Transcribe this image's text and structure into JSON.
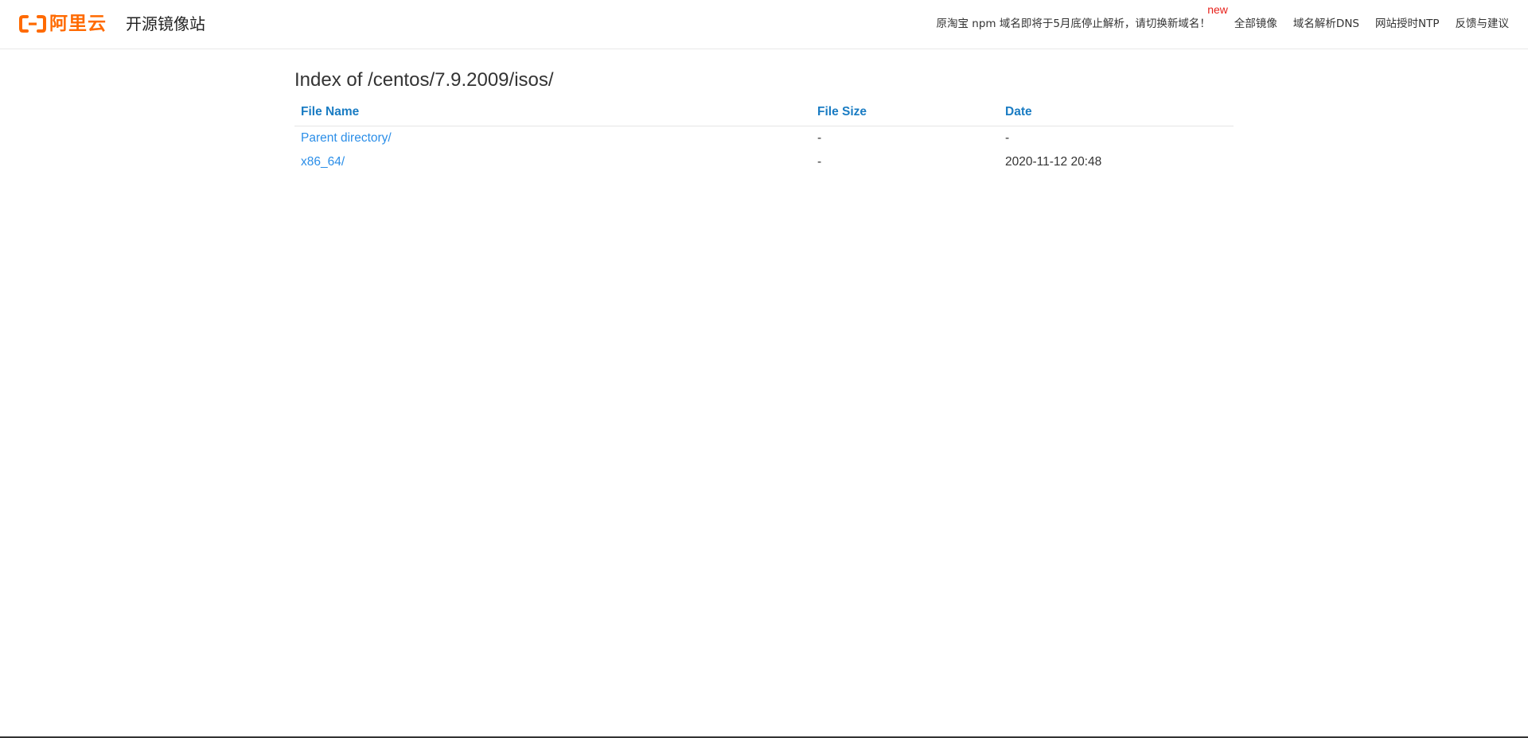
{
  "header": {
    "logo_text": "阿里云",
    "site_title": "开源镜像站",
    "brand_color": "#ff6a00",
    "nav": {
      "notice": "原淘宝 npm 域名即将于5月底停止解析，请切换新域名！",
      "new_badge": "new",
      "items": [
        "全部镜像",
        "域名解析DNS",
        "网站授时NTP",
        "反馈与建议"
      ]
    }
  },
  "main": {
    "title": "Index of /centos/7.9.2009/isos/",
    "table": {
      "columns": [
        "File Name",
        "File Size",
        "Date"
      ],
      "rows": [
        {
          "name": "Parent directory/",
          "size": "-",
          "date": "-"
        },
        {
          "name": "x86_64/",
          "size": "-",
          "date": "2020-11-12 20:48"
        }
      ]
    },
    "link_color": "#2b8ee8",
    "header_color": "#1a7cc3"
  }
}
